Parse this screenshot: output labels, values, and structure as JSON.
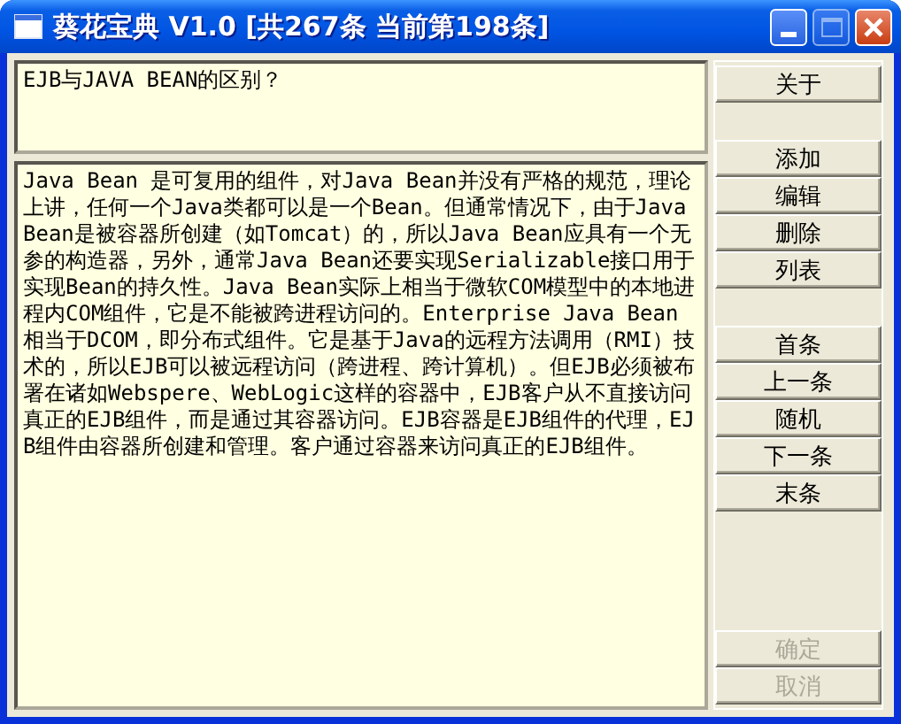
{
  "window": {
    "title": "葵花宝典 V1.0 [共267条 当前第198条]",
    "maximize_disabled": true
  },
  "question": {
    "value": "EJB与JAVA BEAN的区别？"
  },
  "answer": {
    "value": "Java Bean 是可复用的组件，对Java Bean并没有严格的规范，理论上讲，任何一个Java类都可以是一个Bean。但通常情况下，由于Java Bean是被容器所创建（如Tomcat）的，所以Java Bean应具有一个无参的构造器，另外，通常Java Bean还要实现Serializable接口用于实现Bean的持久性。Java Bean实际上相当于微软COM模型中的本地进程内COM组件，它是不能被跨进程访问的。Enterprise Java Bean 相当于DCOM，即分布式组件。它是基于Java的远程方法调用（RMI）技术的，所以EJB可以被远程访问（跨进程、跨计算机）。但EJB必须被布署在诸如Webspere、WebLogic这样的容器中，EJB客户从不直接访问真正的EJB组件，而是通过其容器访问。EJB容器是EJB组件的代理，EJB组件由容器所创建和管理。客户通过容器来访问真正的EJB组件。"
  },
  "button_groups": [
    [
      {
        "label": "关于",
        "disabled": false
      }
    ],
    [
      {
        "label": "添加",
        "disabled": false
      },
      {
        "label": "编辑",
        "disabled": false
      },
      {
        "label": "删除",
        "disabled": false
      },
      {
        "label": "列表",
        "disabled": false
      }
    ],
    [
      {
        "label": "首条",
        "disabled": false
      },
      {
        "label": "上一条",
        "disabled": false
      },
      {
        "label": "随机",
        "disabled": false
      },
      {
        "label": "下一条",
        "disabled": false
      },
      {
        "label": "末条",
        "disabled": false
      }
    ],
    [
      {
        "label": "确定",
        "disabled": true
      },
      {
        "label": "取消",
        "disabled": true
      }
    ]
  ]
}
